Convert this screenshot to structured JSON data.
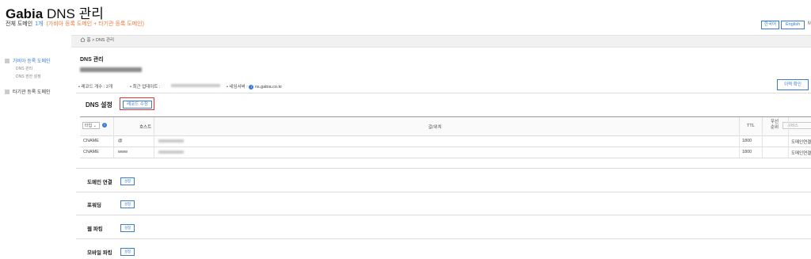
{
  "header": {
    "brand_bold": "Gabia",
    "brand_rest": " DNS 관리",
    "sub_label": "전체 도메인",
    "sub_count": "1개",
    "sub_note": "(가비아 등록 도메인 + 타기관 등록 도메인)",
    "lang_ko": "한국어",
    "lang_en": "English",
    "lang_more": "M"
  },
  "breadcrumb": {
    "home_icon": "home-icon",
    "text": "홈 > DNS 관리"
  },
  "sidebar": {
    "items": [
      {
        "label": "가비아 등록 도메인",
        "active": true
      },
      {
        "label": "DNS 관리"
      },
      {
        "label": "DNS 권한 설정"
      },
      {
        "label": "타기관 등록 도메인"
      }
    ]
  },
  "main": {
    "title": "DNS 관리",
    "record_count_label": "레코드 개수 : 2개",
    "last_update_label": "최근 업데이트 :",
    "nameserver_label": "네임서버 :",
    "nameserver_value": "ns.gabia.co.kr",
    "history_button": "이력 확인",
    "dns_settings_title": "DNS 설정",
    "record_edit_button": "레코드 수정"
  },
  "table": {
    "type_select": "타입",
    "headers": {
      "host": "호스트",
      "value": "값/위치",
      "ttl": "TTL",
      "priority": "우선\n순위",
      "service": "서비스"
    },
    "rows": [
      {
        "type": "CNAME",
        "host": "@",
        "ttl": "1800",
        "service": "도메인연결"
      },
      {
        "type": "CNAME",
        "host": "www",
        "ttl": "1800",
        "service": "도메인연결"
      }
    ]
  },
  "sections": [
    {
      "label": "도메인 연결",
      "button": "설정"
    },
    {
      "label": "포워딩",
      "button": "설정"
    },
    {
      "label": "웹 파킹",
      "button": "설정"
    },
    {
      "label": "모바일 파킹",
      "button": "설정"
    }
  ],
  "colors": {
    "accent": "#3a7bd5",
    "note_orange": "#f07a3a",
    "highlight_red": "#e3342f"
  }
}
